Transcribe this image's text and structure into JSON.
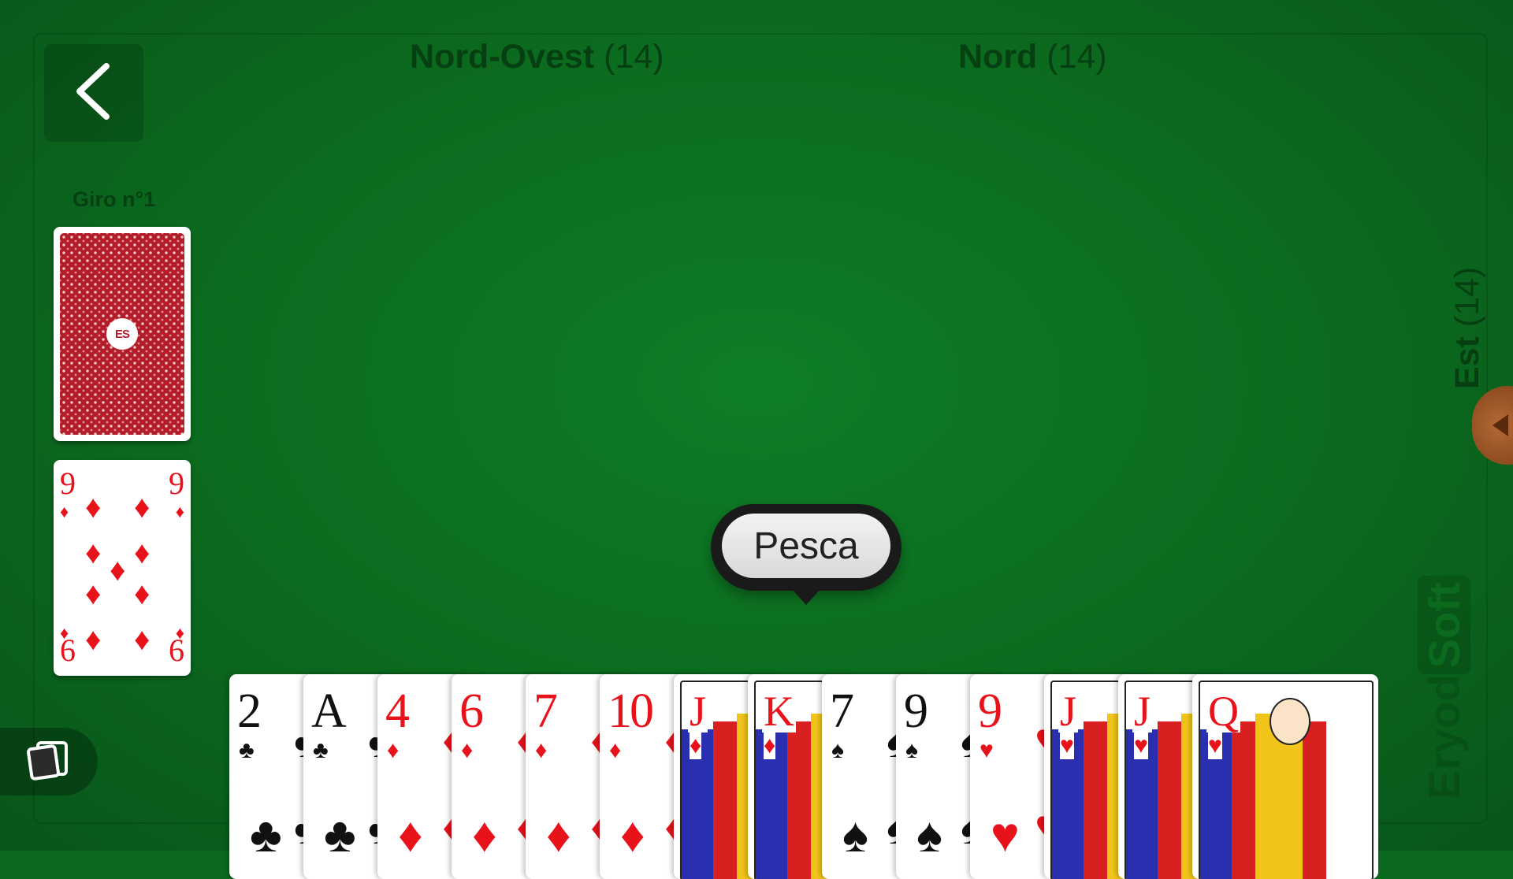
{
  "players": {
    "north_west": {
      "name": "Nord-Ovest",
      "count": "(14)"
    },
    "north": {
      "name": "Nord",
      "count": "(14)"
    },
    "east": {
      "name": "Est",
      "count": "(14)"
    }
  },
  "round_label": "Giro n°1",
  "deck": {
    "logo": "ES"
  },
  "discard": {
    "rank": "9",
    "rank_flipped": "6",
    "suit": "♦",
    "color": "#e8121b"
  },
  "bubble": {
    "label": "Pesca"
  },
  "watermark": {
    "part1": "Eryod",
    "part2": "Soft"
  },
  "hand": [
    {
      "rank": "2",
      "suit": "♣",
      "color": "black",
      "court": false
    },
    {
      "rank": "A",
      "suit": "♣",
      "color": "black",
      "court": false
    },
    {
      "rank": "4",
      "suit": "♦",
      "color": "red",
      "court": false
    },
    {
      "rank": "6",
      "suit": "♦",
      "color": "red",
      "court": false
    },
    {
      "rank": "7",
      "suit": "♦",
      "color": "red",
      "court": false
    },
    {
      "rank": "10",
      "suit": "♦",
      "color": "red",
      "court": false
    },
    {
      "rank": "J",
      "suit": "♦",
      "color": "red",
      "court": true
    },
    {
      "rank": "K",
      "suit": "♦",
      "color": "red",
      "court": true
    },
    {
      "rank": "7",
      "suit": "♠",
      "color": "black",
      "court": false
    },
    {
      "rank": "9",
      "suit": "♠",
      "color": "black",
      "court": false
    },
    {
      "rank": "9",
      "suit": "♥",
      "color": "red",
      "court": false
    },
    {
      "rank": "J",
      "suit": "♥",
      "color": "red",
      "court": true
    },
    {
      "rank": "J",
      "suit": "♥",
      "color": "red",
      "court": true
    },
    {
      "rank": "Q",
      "suit": "♥",
      "color": "red",
      "court": true
    }
  ],
  "icons": {
    "back": "chevron-left-icon",
    "menu": "cards-stack-icon",
    "handle": "triangle-left-icon"
  }
}
